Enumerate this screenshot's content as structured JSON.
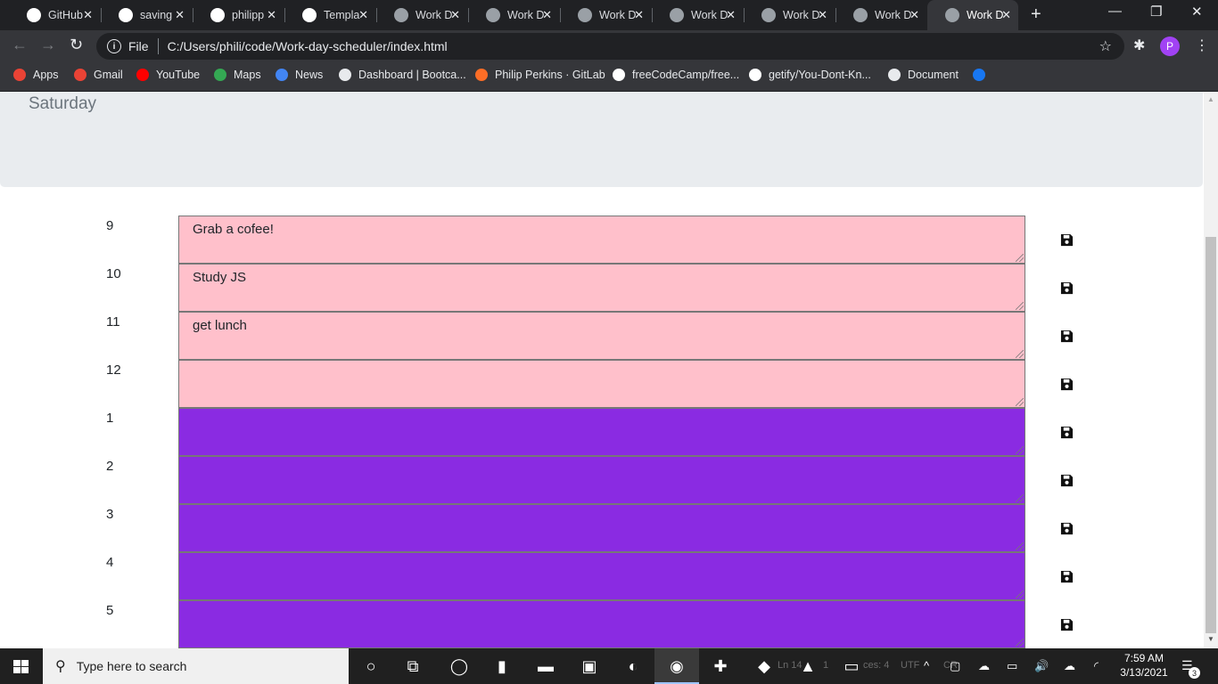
{
  "browser": {
    "tabs": [
      {
        "title": "GitHub",
        "icon": "github-icon",
        "icon_color": "#ffffff"
      },
      {
        "title": "saving",
        "icon": "google-icon",
        "icon_color": "#ffffff"
      },
      {
        "title": "philipp",
        "icon": "github-icon",
        "icon_color": "#ffffff"
      },
      {
        "title": "Templa",
        "icon": "mortarboard-icon",
        "icon_color": "#ffffff"
      },
      {
        "title": "Work D",
        "icon": "globe-icon",
        "icon_color": "#9aa0a6"
      },
      {
        "title": "Work D",
        "icon": "globe-icon",
        "icon_color": "#9aa0a6"
      },
      {
        "title": "Work D",
        "icon": "globe-icon",
        "icon_color": "#9aa0a6"
      },
      {
        "title": "Work D",
        "icon": "globe-icon",
        "icon_color": "#9aa0a6"
      },
      {
        "title": "Work D",
        "icon": "globe-icon",
        "icon_color": "#9aa0a6"
      },
      {
        "title": "Work D",
        "icon": "globe-icon",
        "icon_color": "#9aa0a6"
      },
      {
        "title": "Work D",
        "icon": "globe-icon",
        "icon_color": "#9aa0a6",
        "active": true
      }
    ],
    "tab_close_glyph": "✕",
    "new_tab_glyph": "+",
    "window_controls": {
      "minimize": "—",
      "restore": "❐",
      "close": "✕"
    },
    "nav": {
      "back": "←",
      "forward": "→",
      "reload": "↻"
    },
    "address": {
      "scheme_label": "File",
      "info_glyph": "i",
      "url": "C:/Users/phili/code/Work-day-scheduler/index.html",
      "bookmark_glyph": "☆"
    },
    "extensions_glyph": "✱",
    "profile_initial": "P",
    "profile_color": "#a142f4",
    "menu_glyph": "⋮",
    "bookmarks": [
      {
        "label": "Apps",
        "icon": "apps-grid-icon",
        "icon_color": "#ea4335"
      },
      {
        "label": "Gmail",
        "icon": "gmail-icon",
        "icon_color": "#ea4335"
      },
      {
        "label": "YouTube",
        "icon": "youtube-icon",
        "icon_color": "#ff0000"
      },
      {
        "label": "Maps",
        "icon": "maps-pin-icon",
        "icon_color": "#34a853"
      },
      {
        "label": "News",
        "icon": "news-icon",
        "icon_color": "#4285f4"
      },
      {
        "label": "Dashboard | Bootca...",
        "icon": "globe-icon",
        "icon_color": "#e8eaed"
      },
      {
        "label": "Philip Perkins · GitLab",
        "icon": "gitlab-icon",
        "icon_color": "#fc6d26"
      },
      {
        "label": "freeCodeCamp/free...",
        "icon": "github-icon",
        "icon_color": "#ffffff"
      },
      {
        "label": "getify/You-Dont-Kn...",
        "icon": "github-icon",
        "icon_color": "#ffffff"
      },
      {
        "label": "Document",
        "icon": "globe-icon",
        "icon_color": "#e8eaed"
      },
      {
        "label": "",
        "icon": "facebook-icon",
        "icon_color": "#1877f2"
      }
    ]
  },
  "page": {
    "current_day": "Saturday",
    "colors": {
      "present": "#ffc0cb",
      "future": "#8a2be2",
      "jumbotron": "#e9ecef"
    },
    "time_blocks": [
      {
        "hour": "9",
        "text": "Grab a cofee!",
        "state": "present"
      },
      {
        "hour": "10",
        "text": "Study JS",
        "state": "present"
      },
      {
        "hour": "11",
        "text": "get lunch",
        "state": "present"
      },
      {
        "hour": "12",
        "text": "",
        "state": "present"
      },
      {
        "hour": "1",
        "text": "",
        "state": "future"
      },
      {
        "hour": "2",
        "text": "",
        "state": "future"
      },
      {
        "hour": "3",
        "text": "",
        "state": "future"
      },
      {
        "hour": "4",
        "text": "",
        "state": "future"
      },
      {
        "hour": "5",
        "text": "",
        "state": "future"
      }
    ],
    "save_icon": "floppy-disk-icon"
  },
  "scrollbar": {
    "up_glyph": "▲",
    "down_glyph": "▼"
  },
  "taskbar": {
    "search_placeholder": "Type here to search",
    "search_glyph": "⚲",
    "apps": [
      {
        "name": "cortana-icon",
        "glyph": "○"
      },
      {
        "name": "task-view-icon",
        "glyph": "⧉"
      },
      {
        "name": "alexa-icon",
        "glyph": "◯"
      },
      {
        "name": "office-icon",
        "glyph": "▮"
      },
      {
        "name": "file-explorer-icon",
        "glyph": "▬"
      },
      {
        "name": "store-icon",
        "glyph": "▣"
      },
      {
        "name": "edge-icon",
        "glyph": "◐"
      },
      {
        "name": "chrome-icon",
        "glyph": "◉"
      },
      {
        "name": "slack-icon",
        "glyph": "✚"
      },
      {
        "name": "vscode-icon",
        "glyph": "◆"
      },
      {
        "name": "photos-icon",
        "glyph": "▲"
      },
      {
        "name": "terminal-icon",
        "glyph": "▭"
      }
    ],
    "ghost_text": [
      "Ln 14",
      "1",
      "ces: 4",
      "UTF",
      "CR"
    ],
    "tray_icons": [
      {
        "name": "chevron-up-icon",
        "glyph": "^"
      },
      {
        "name": "meet-now-icon",
        "glyph": "▢"
      },
      {
        "name": "onedrive-icon",
        "glyph": "☁"
      },
      {
        "name": "battery-icon",
        "glyph": "▭"
      },
      {
        "name": "volume-icon",
        "glyph": "🔊"
      },
      {
        "name": "cloud-upload-icon",
        "glyph": "☁"
      },
      {
        "name": "wifi-icon",
        "glyph": "◜"
      }
    ],
    "clock_time": "7:59 AM",
    "clock_date": "3/13/2021",
    "notification_glyph": "☰",
    "notification_count": "3"
  }
}
